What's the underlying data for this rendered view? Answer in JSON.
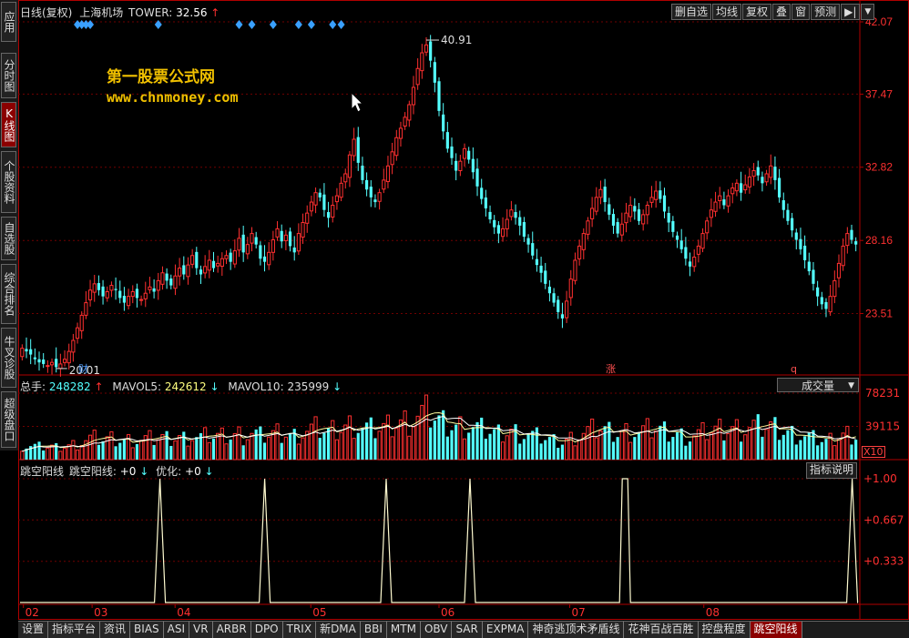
{
  "sidebar": {
    "items": [
      {
        "label": "应用"
      },
      {
        "label": "分时图"
      },
      {
        "label": "K线图",
        "active": true
      },
      {
        "label": "个股资料"
      },
      {
        "label": "自选股"
      },
      {
        "label": "综合排名"
      },
      {
        "label": "牛叉诊股"
      },
      {
        "label": "超级盘口"
      }
    ]
  },
  "header": {
    "period": "日线(复权)",
    "stock_name": "上海机场",
    "indicator": "TOWER:",
    "value": "32.56",
    "arrow": "↑"
  },
  "toolbar": {
    "buttons": [
      "删自选",
      "均线",
      "复权",
      "叠",
      "窗",
      "预测"
    ],
    "nav_icon": "play-end-icon",
    "menu_icon": "chevron-down-icon"
  },
  "watermark": {
    "line1": "第一股票公式网",
    "line2": "www.chnmoney.com"
  },
  "price_panel": {
    "high_label": "40.91",
    "low_label": "20.01",
    "marks": [
      "财",
      "涨",
      "q"
    ]
  },
  "volume_panel": {
    "title": "总手:",
    "total": "248282",
    "total_arrow": "↑",
    "mavol5_label": "MAVOL5:",
    "mavol5": "242612",
    "mavol5_arrow": "↓",
    "mavol10_label": "MAVOL10:",
    "mavol10": "235999",
    "mavol10_arrow": "↓",
    "selector": "成交量",
    "scale_label": "X10"
  },
  "indicator_panel": {
    "name": "跳空阳线",
    "line_label": "跳空阳线:",
    "line_value": "+0",
    "line_arrow": "↓",
    "opt_label": "优化:",
    "opt_value": "+0",
    "opt_arrow": "↓",
    "button": "指标说明"
  },
  "bottom_tabs": {
    "items": [
      "设置",
      "指标平台",
      "资讯",
      "BIAS",
      "ASI",
      "VR",
      "ARBR",
      "DPO",
      "TRIX",
      "新DMA",
      "BBI",
      "MTM",
      "OBV",
      "SAR",
      "EXPMA",
      "神奇逃顶术矛盾线",
      "花神百战百胜",
      "控盘程度",
      "跳空阳线"
    ],
    "active": "跳空阳线"
  },
  "colors": {
    "up": "#ff3030",
    "down": "#54ffff",
    "axis": "#b00000",
    "text": "#dddddd",
    "accent": "#f0c000",
    "indicator_line": "#fffbd0"
  },
  "chart_data": [
    {
      "type": "candlestick",
      "title": "",
      "y_axis_ticks": [
        "42.07",
        "37.47",
        "32.82",
        "28.16",
        "23.51"
      ],
      "ylim": [
        19.6,
        42.07
      ],
      "x_ticks": [
        "02",
        "03",
        "04",
        "05",
        "06",
        "07",
        "08"
      ],
      "annotations": [
        {
          "text": "40.91",
          "type": "high"
        },
        {
          "text": "20.01",
          "type": "low"
        }
      ],
      "signal_count": 12,
      "closes": [
        21.3,
        21.1,
        20.9,
        20.6,
        20.4,
        20.3,
        20.2,
        20.4,
        20.1,
        20.3,
        20.6,
        21.1,
        21.8,
        22.6,
        23.4,
        24.2,
        25.0,
        25.4,
        25.0,
        24.6,
        24.9,
        25.3,
        25.0,
        24.5,
        24.2,
        24.6,
        24.9,
        24.5,
        24.4,
        24.8,
        25.2,
        24.9,
        25.6,
        26.1,
        25.6,
        25.3,
        25.9,
        26.4,
        26.0,
        26.6,
        27.2,
        26.4,
        26.0,
        26.5,
        26.9,
        26.4,
        26.7,
        27.0,
        27.2,
        26.8,
        27.5,
        28.3,
        27.4,
        27.9,
        28.6,
        27.9,
        27.0,
        26.8,
        27.4,
        28.2,
        28.9,
        28.1,
        28.5,
        27.8,
        27.4,
        28.6,
        29.3,
        29.9,
        30.6,
        31.2,
        30.9,
        30.1,
        29.6,
        30.4,
        31.0,
        31.8,
        32.4,
        33.6,
        34.6,
        33.1,
        32.0,
        31.4,
        30.9,
        30.6,
        31.2,
        32.0,
        32.9,
        33.8,
        34.7,
        35.3,
        36.0,
        36.8,
        37.9,
        39.1,
        40.1,
        40.6,
        39.6,
        38.2,
        36.4,
        35.1,
        34.0,
        33.4,
        32.6,
        33.2,
        34.0,
        33.3,
        32.5,
        31.6,
        30.8,
        30.2,
        29.5,
        29.0,
        28.6,
        28.9,
        29.5,
        30.1,
        29.6,
        29.1,
        28.4,
        27.9,
        27.2,
        26.6,
        26.1,
        25.4,
        24.8,
        24.2,
        23.6,
        23.2,
        24.3,
        25.7,
        26.9,
        27.8,
        28.6,
        29.4,
        30.2,
        30.9,
        31.4,
        30.6,
        29.8,
        29.1,
        28.6,
        29.2,
        29.9,
        30.4,
        30.0,
        29.4,
        29.8,
        30.4,
        30.9,
        31.3,
        30.8,
        30.0,
        29.3,
        28.7,
        28.2,
        27.6,
        27.0,
        26.5,
        27.1,
        27.8,
        28.6,
        29.4,
        30.1,
        30.6,
        31.0,
        30.4,
        31.0,
        31.5,
        31.8,
        31.2,
        31.7,
        32.2,
        32.6,
        32.3,
        31.8,
        32.4,
        32.9,
        32.0,
        30.9,
        30.1,
        29.4,
        28.8,
        28.2,
        27.6,
        26.9,
        26.2,
        25.4,
        24.6,
        24.1,
        23.8,
        24.6,
        25.6,
        26.7,
        27.8,
        28.6,
        28.2,
        27.9
      ]
    },
    {
      "type": "bar",
      "title": "成交量",
      "y_axis_ticks": [
        "78231",
        "39115"
      ],
      "ylim": [
        0,
        78231
      ],
      "series": [
        {
          "name": "MAVOL5"
        },
        {
          "name": "MAVOL10"
        }
      ]
    },
    {
      "type": "line",
      "title": "跳空阳线",
      "y_axis_ticks": [
        "+1.00",
        "+0.667",
        "+0.333"
      ],
      "ylim": [
        0,
        1
      ],
      "spike_fractions": [
        0.167,
        0.292,
        0.437,
        0.537,
        0.722,
        0.993
      ],
      "x_ticks": [
        "02",
        "03",
        "04",
        "05",
        "06",
        "07",
        "08"
      ]
    }
  ]
}
